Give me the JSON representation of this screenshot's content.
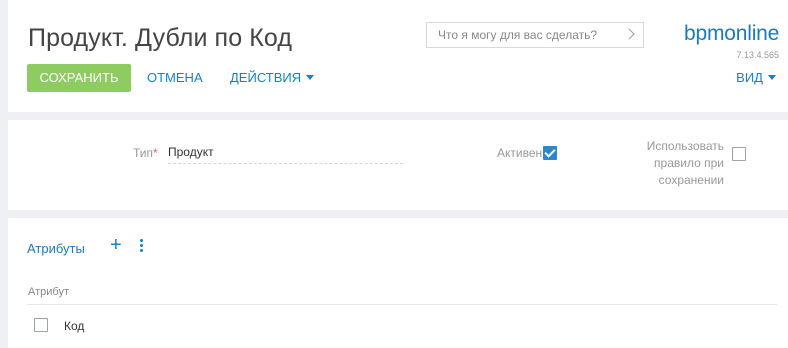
{
  "header": {
    "title": "Продукт. Дубли по Код",
    "save_label": "СОХРАНИТЬ",
    "cancel_label": "ОТМЕНА",
    "actions_label": "ДЕЙСТВИЯ",
    "search_placeholder": "Что я могу для вас сделать?",
    "logo_text_a": "bpm",
    "logo_text_b": "online",
    "version": "7.13.4.565",
    "view_label": "ВИД"
  },
  "form": {
    "type_label": "Тип",
    "type_required_mark": "*",
    "type_value": "Продукт",
    "active_label": "Активен",
    "active_checked": true,
    "use_rule_label": "Использовать правило при сохранении",
    "use_rule_checked": false
  },
  "grid": {
    "title": "Атрибуты",
    "add_icon": "plus-icon",
    "menu_icon": "vertical-ellipsis-icon",
    "column_header": "Атрибут",
    "rows": [
      {
        "label": "Код",
        "checked": false
      }
    ]
  },
  "colors": {
    "accent": "#0e84cf",
    "save_button": "#8ecb60",
    "checkbox_checked": "#2a87d0",
    "required": "#f35b5b"
  }
}
